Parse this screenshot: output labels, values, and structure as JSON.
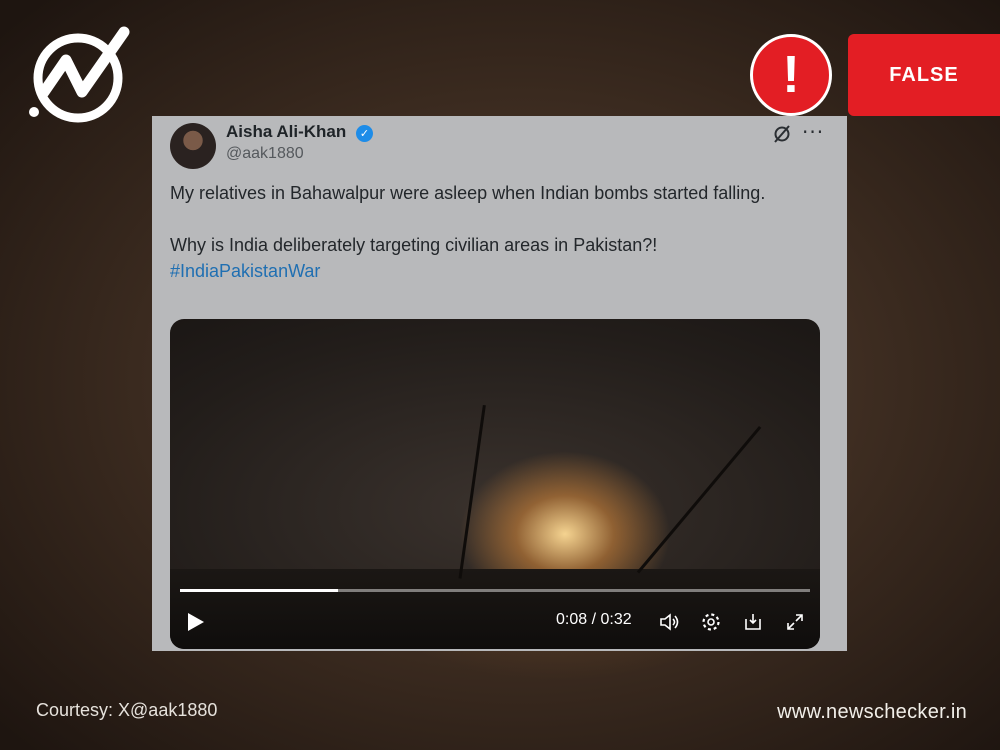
{
  "verdict": {
    "label": "FALSE",
    "color": "#e31e24",
    "icon": "exclamation-icon"
  },
  "tweet": {
    "author_name": "Aisha Ali-Khan",
    "handle": "@aak1880",
    "verified_icon": "verified-badge-icon",
    "text_line1": "My relatives in Bahawalpur were asleep when Indian bombs started falling.",
    "text_line2": "Why is India deliberately targeting civilian areas in Pakistan?!",
    "hashtag": "#IndiaPakistanWar"
  },
  "video": {
    "time": "0:08 / 0:32",
    "progress": 0.25
  },
  "footer": {
    "courtesy": "Courtesy: X@aak1880",
    "site": "www.newschecker.in"
  }
}
